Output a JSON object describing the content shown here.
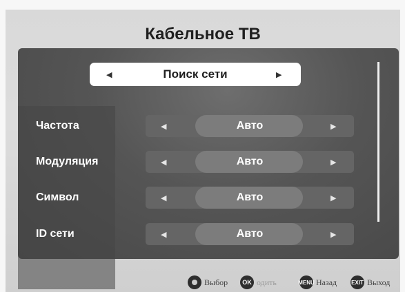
{
  "title": "Кабельное ТВ",
  "top_selector": {
    "value": "Поиск сети",
    "left_arrow": "◀",
    "right_arrow": "▶"
  },
  "rows": [
    {
      "label": "Частота",
      "value": "Авто",
      "left_arrow": "◀",
      "right_arrow": "▶"
    },
    {
      "label": "Модуляция",
      "value": "Авто",
      "left_arrow": "◀",
      "right_arrow": "▶"
    },
    {
      "label": "Символ",
      "value": "Авто",
      "left_arrow": "◀",
      "right_arrow": "▶"
    },
    {
      "label": "ID сети",
      "value": "Авто",
      "left_arrow": "◀",
      "right_arrow": "▶"
    }
  ],
  "footer": {
    "select_label": "Выбор",
    "ok_icon": "OK",
    "enter_label": "одить",
    "menu_icon": "MENU",
    "back_label": "Назад",
    "exit_icon": "EXIT",
    "exit_label": "Выход"
  }
}
